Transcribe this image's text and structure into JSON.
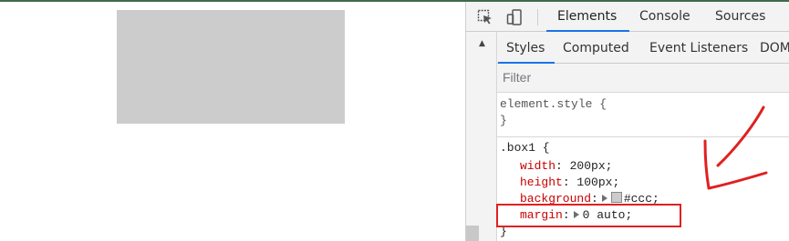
{
  "devtools": {
    "main_tabs": [
      {
        "label": "Elements"
      },
      {
        "label": "Console"
      },
      {
        "label": "Sources"
      }
    ],
    "sub_tabs": [
      {
        "label": "Styles"
      },
      {
        "label": "Computed"
      },
      {
        "label": "Event Listeners"
      },
      {
        "label": "DOM"
      }
    ],
    "filter": {
      "placeholder": "Filter",
      "value": ""
    },
    "element_style": {
      "open": "element.style {",
      "close": "}"
    },
    "box1_rule": {
      "selector": ".box1 {",
      "close": "}",
      "declarations": [
        {
          "prop": "width",
          "value": "200px"
        },
        {
          "prop": "height",
          "value": "100px"
        },
        {
          "prop": "background",
          "value": "#ccc"
        },
        {
          "prop": "margin",
          "value": "0 auto"
        }
      ]
    }
  },
  "colors": {
    "box_fill": "#cccccc",
    "highlight": "#e02020",
    "accent": "#1a73e8"
  },
  "icons": [
    "inspect-element-icon",
    "device-toggle-icon",
    "scroll-up-arrow-icon",
    "color-swatch-icon",
    "expand-triangle-icon"
  ]
}
